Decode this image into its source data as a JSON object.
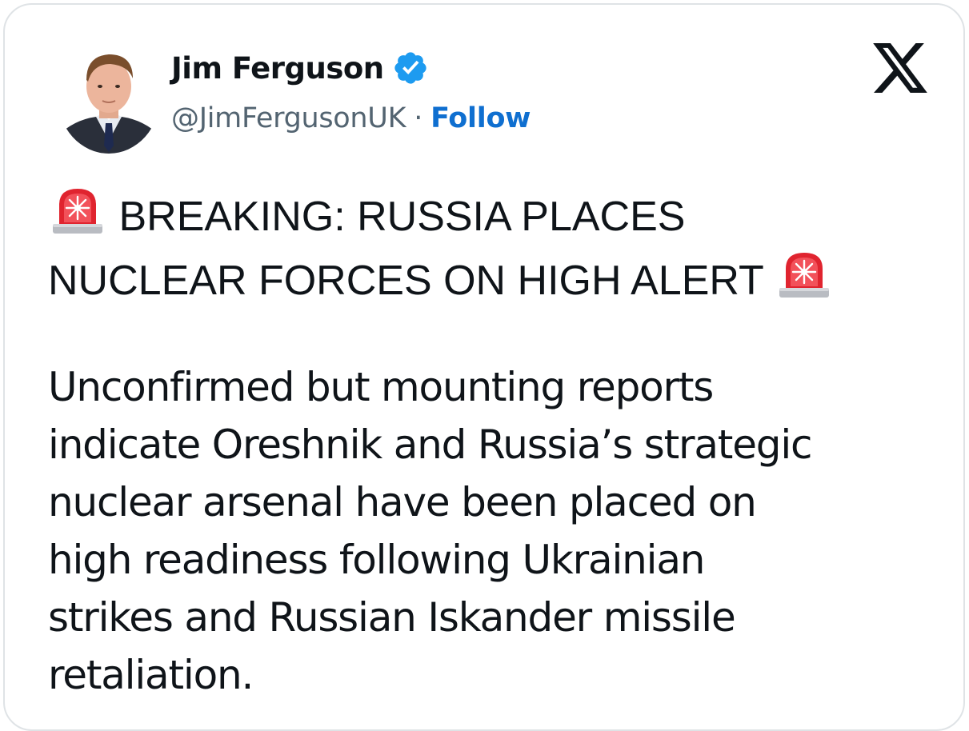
{
  "tweet": {
    "author": {
      "name": "Jim Ferguson",
      "handle": "@JimFergusonUK",
      "separator": "·",
      "follow_label": "Follow",
      "verified": true,
      "avatar": "avatar-photo"
    },
    "platform_icon": "x-logo-icon",
    "headline": {
      "line1": "BREAKING: RUSSIA PLACES",
      "line2": "NUCLEAR FORCES ON HIGH ALERT",
      "emoji": "rotating-light-siren-icon"
    },
    "body": "Unconfirmed but mounting reports\nindicate Oreshnik and Russia’s strategic\nnuclear arsenal have been placed on\nhigh readiness following Ukrainian\nstrikes and Russian Iskander missile\nretaliation."
  },
  "colors": {
    "text": "#0f1419",
    "secondary": "#536471",
    "follow": "#0f6fd0",
    "verified": "#1d9bf0",
    "border": "#dfe3e6",
    "siren": "#e0242f"
  }
}
